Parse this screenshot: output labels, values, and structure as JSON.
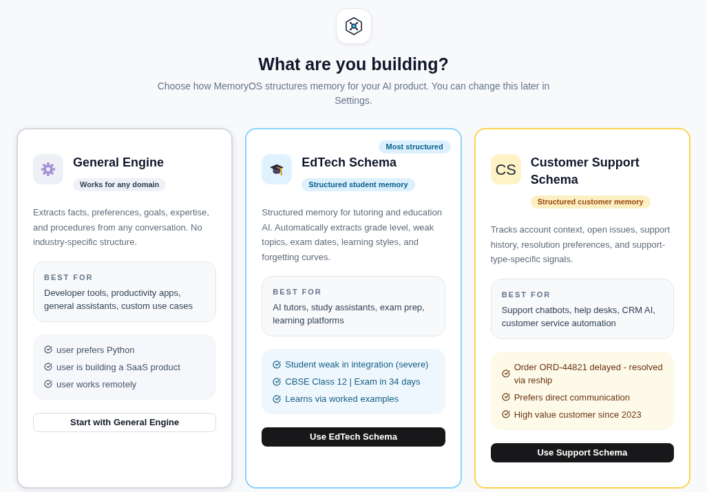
{
  "header": {
    "title": "What are you building?",
    "subtitle": "Choose how MemoryOS structures memory for your AI product. You can change this later in Settings."
  },
  "cards": [
    {
      "kind": "general",
      "title": "General Engine",
      "tag": "Works for any domain",
      "description": "Extracts facts, preferences, goals, expertise, and procedures from any conversation. No industry-specific structure.",
      "best_for_label": "BEST FOR",
      "best_for": "Developer tools, productivity apps, general assistants, custom use cases",
      "examples": [
        "user prefers Python",
        "user is building a SaaS product",
        "user works remotely"
      ],
      "button": "Start with General Engine"
    },
    {
      "kind": "edtech",
      "badge": "Most structured",
      "title": "EdTech Schema",
      "tag": "Structured student memory",
      "description": "Structured memory for tutoring and education AI. Automatically extracts grade level, weak topics, exam dates, learning styles, and forgetting curves.",
      "best_for_label": "BEST FOR",
      "best_for": "AI tutors, study assistants, exam prep, learning platforms",
      "examples": [
        "Student weak in integration (severe)",
        "CBSE Class 12 | Exam in 34 days",
        "Learns via worked examples"
      ],
      "button": "Use EdTech Schema"
    },
    {
      "kind": "support",
      "icon_text": "CS",
      "title": "Customer Support Schema",
      "tag": "Structured customer memory",
      "description": "Tracks account context, open issues, support history, resolution preferences, and support-type-specific signals.",
      "best_for_label": "BEST FOR",
      "best_for": "Support chatbots, help desks, CRM AI, customer service automation",
      "examples": [
        "Order ORD-44821 delayed - resolved via reship",
        "Prefers direct communication",
        "High value customer since 2023"
      ],
      "button": "Use Support Schema"
    }
  ]
}
